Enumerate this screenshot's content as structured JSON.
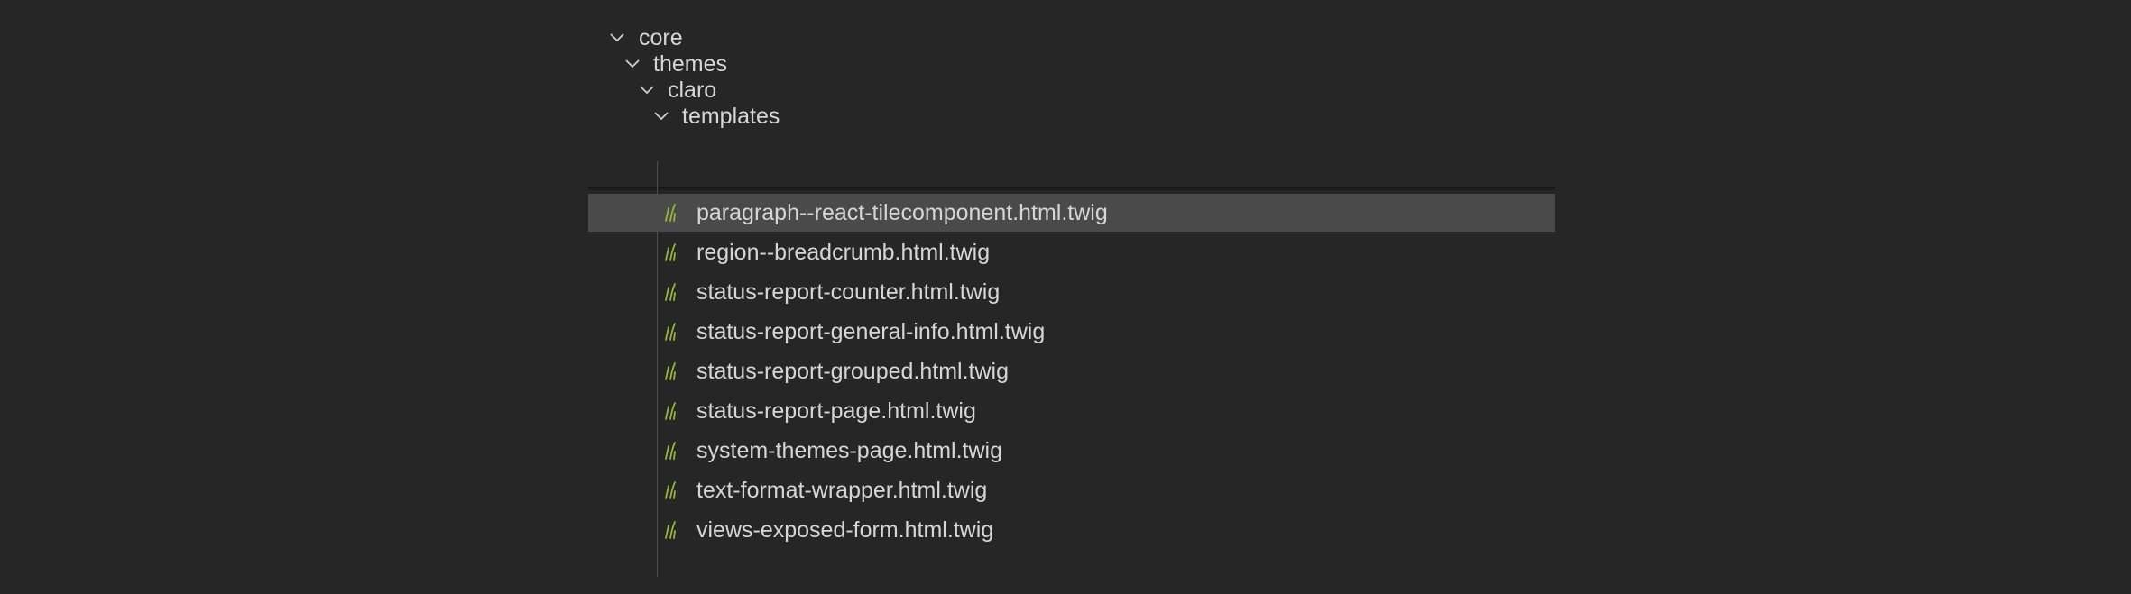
{
  "explorer": {
    "folders": [
      {
        "label": "core",
        "state": "expanded"
      },
      {
        "label": "themes",
        "state": "expanded"
      },
      {
        "label": "claro",
        "state": "expanded"
      },
      {
        "label": "templates",
        "state": "expanded"
      }
    ],
    "files": [
      {
        "label": "paragraph--react-tilecomponent.html.twig",
        "icon": "twig-file-icon",
        "selected": true
      },
      {
        "label": "region--breadcrumb.html.twig",
        "icon": "twig-file-icon"
      },
      {
        "label": "status-report-counter.html.twig",
        "icon": "twig-file-icon"
      },
      {
        "label": "status-report-general-info.html.twig",
        "icon": "twig-file-icon"
      },
      {
        "label": "status-report-grouped.html.twig",
        "icon": "twig-file-icon"
      },
      {
        "label": "status-report-page.html.twig",
        "icon": "twig-file-icon"
      },
      {
        "label": "system-themes-page.html.twig",
        "icon": "twig-file-icon"
      },
      {
        "label": "text-format-wrapper.html.twig",
        "icon": "twig-file-icon"
      },
      {
        "label": "views-exposed-form.html.twig",
        "icon": "twig-file-icon"
      }
    ]
  },
  "colors": {
    "background": "#262626",
    "text": "#d6d6d6",
    "selected_row": "#4a4a4a",
    "twig_icon": "#9ab63a",
    "indent_guide": "#4d4d4d"
  }
}
